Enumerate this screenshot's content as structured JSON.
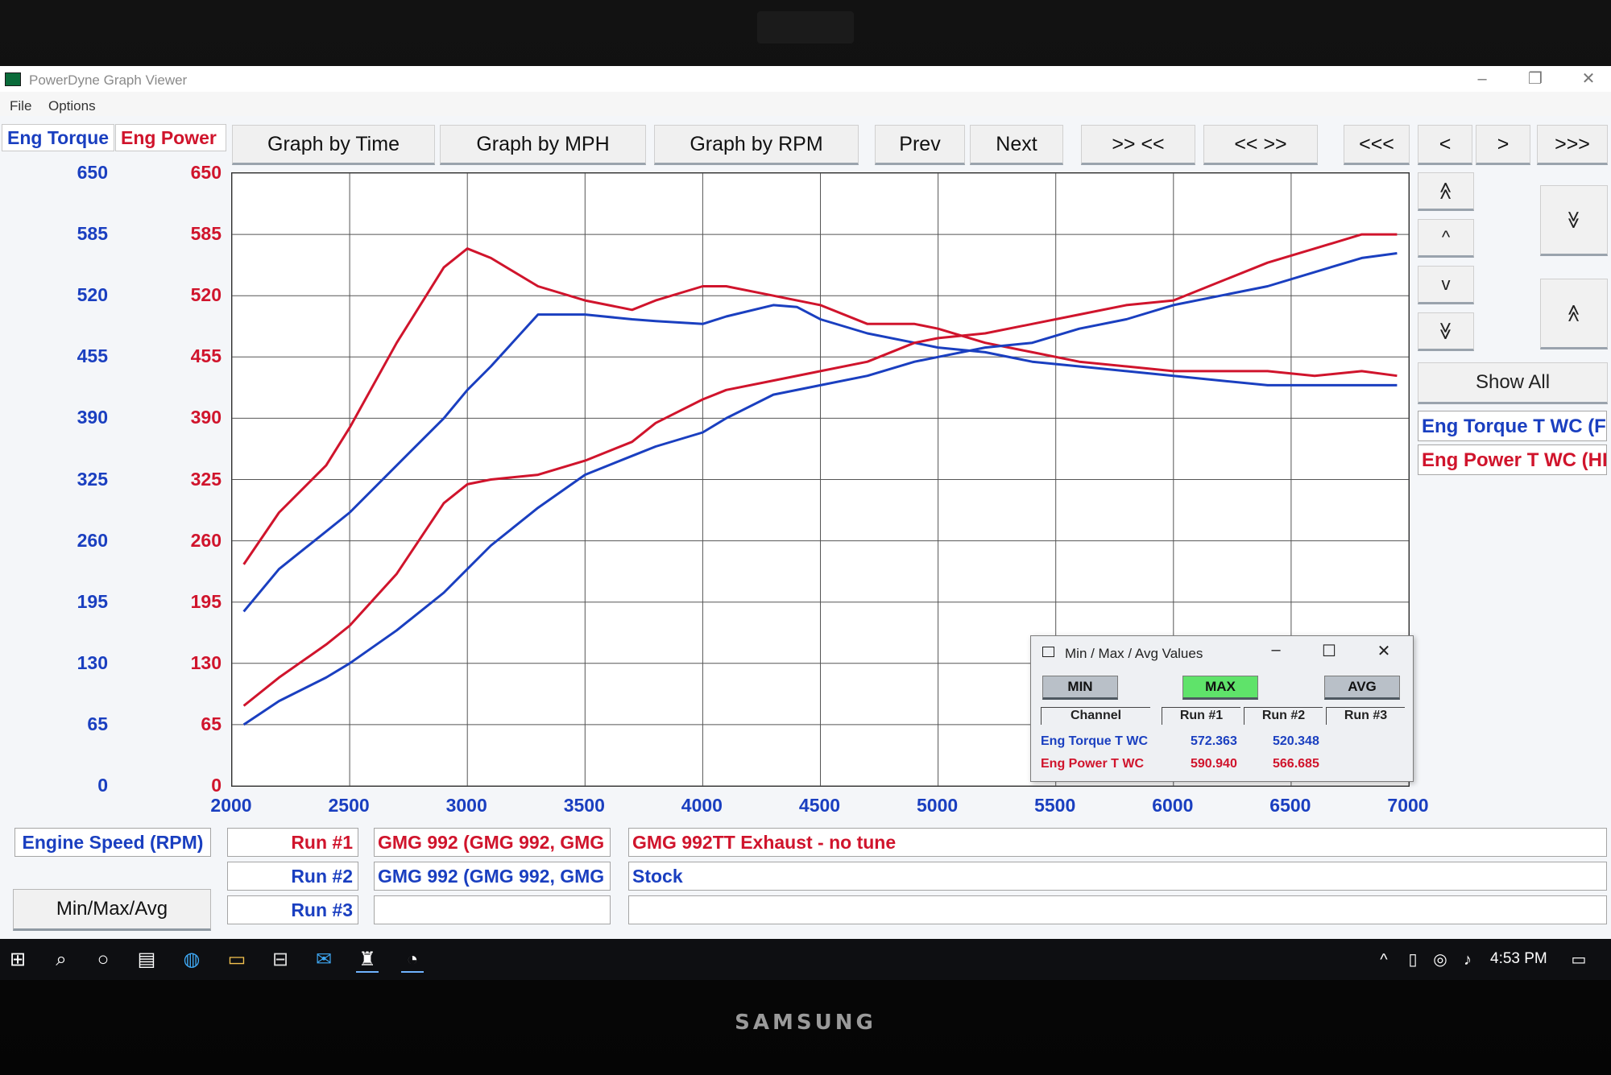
{
  "device": {
    "brand": "SAMSUNG"
  },
  "window": {
    "title": "PowerDyne Graph Viewer",
    "controls": {
      "minimize": "–",
      "restore": "❐",
      "close": "✕"
    },
    "menu": [
      "File",
      "Options"
    ]
  },
  "axes": {
    "torque_header": "Eng Torque",
    "power_header": "Eng Power",
    "y_ticks": [
      "650",
      "585",
      "520",
      "455",
      "390",
      "325",
      "260",
      "195",
      "130",
      "65",
      "0"
    ],
    "x_ticks": [
      "2000",
      "2500",
      "3000",
      "3500",
      "4000",
      "4500",
      "5000",
      "5500",
      "6000",
      "6500",
      "7000"
    ]
  },
  "toolbar": {
    "graph_by_time": "Graph by Time",
    "graph_by_mph": "Graph by MPH",
    "graph_by_rpm": "Graph by RPM",
    "prev": "Prev",
    "next": "Next",
    "zoom_in": ">> <<",
    "zoom_out": "<< >>",
    "first": "<<<",
    "back": "<",
    "forward": ">",
    "last": ">>>"
  },
  "right_panel": {
    "expand_up": "≫",
    "up": "^",
    "down": "v",
    "expand_down": "≫",
    "show_all": "Show All",
    "legend_torque": "Eng Torque T WC (F",
    "legend_power": "Eng Power T WC (HI"
  },
  "bottom": {
    "x_channel": "Engine Speed (RPM)",
    "minmax_button": "Min/Max/Avg",
    "runs": [
      {
        "label": "Run #1",
        "vehicle": "GMG 992 (GMG 992, GMG",
        "note": "GMG 992TT Exhaust - no tune"
      },
      {
        "label": "Run #2",
        "vehicle": "GMG 992 (GMG 992, GMG",
        "note": "Stock"
      },
      {
        "label": "Run #3",
        "vehicle": "",
        "note": ""
      }
    ]
  },
  "minmax": {
    "title": "Min / Max / Avg Values",
    "min": "MIN",
    "max": "MAX",
    "avg": "AVG",
    "headers": [
      "Channel",
      "Run #1",
      "Run #2",
      "Run #3"
    ],
    "rows": [
      {
        "channel": "Eng Torque T WC",
        "run1": "572.363",
        "run2": "520.348",
        "color": "#1a3fc0"
      },
      {
        "channel": "Eng Power T WC",
        "run1": "590.940",
        "run2": "566.685",
        "color": "#d0142c"
      }
    ]
  },
  "taskbar": {
    "time": "4:53 PM"
  },
  "colors": {
    "torque": "#1a3fc0",
    "power": "#d0142c",
    "max_active": "#5fe36a"
  },
  "chart_data": {
    "type": "line",
    "x_label": "Engine Speed (RPM)",
    "xlim": [
      2000,
      7000
    ],
    "ylim": [
      0,
      650
    ],
    "grid": true,
    "series": [
      {
        "name": "Eng Power T WC",
        "run": "Run #1",
        "color": "#d0142c",
        "x": [
          2050,
          2200,
          2400,
          2500,
          2700,
          2900,
          3000,
          3100,
          3300,
          3500,
          3700,
          3800,
          4000,
          4100,
          4300,
          4500,
          4700,
          4900,
          5000,
          5200,
          5400,
          5600,
          5800,
          6000,
          6200,
          6400,
          6600,
          6800,
          6950
        ],
        "y": [
          235,
          290,
          340,
          380,
          470,
          550,
          570,
          560,
          530,
          515,
          505,
          515,
          530,
          530,
          520,
          510,
          490,
          490,
          485,
          470,
          460,
          450,
          445,
          440,
          440,
          440,
          435,
          440,
          435
        ]
      },
      {
        "name": "Eng Torque T WC",
        "run": "Run #1",
        "color": "#1a3fc0",
        "x": [
          2050,
          2200,
          2400,
          2500,
          2700,
          2900,
          3000,
          3100,
          3300,
          3500,
          3700,
          3800,
          4000,
          4100,
          4300,
          4400,
          4500,
          4700,
          4900,
          5000,
          5200,
          5400,
          5600,
          5800,
          6000,
          6200,
          6400,
          6600,
          6800,
          6950
        ],
        "y": [
          185,
          230,
          270,
          290,
          340,
          390,
          420,
          445,
          500,
          500,
          495,
          493,
          490,
          498,
          510,
          508,
          495,
          480,
          470,
          465,
          460,
          450,
          445,
          440,
          435,
          430,
          425,
          425,
          425,
          425
        ]
      },
      {
        "name": "Eng Power T WC",
        "run": "Run #2",
        "color": "#d0142c",
        "x": [
          2050,
          2200,
          2400,
          2500,
          2700,
          2900,
          3000,
          3100,
          3300,
          3500,
          3700,
          3800,
          4000,
          4100,
          4300,
          4500,
          4700,
          4900,
          5000,
          5200,
          5400,
          5600,
          5800,
          6000,
          6200,
          6400,
          6600,
          6800,
          6950
        ],
        "y": [
          85,
          115,
          150,
          170,
          225,
          300,
          320,
          325,
          330,
          345,
          365,
          385,
          410,
          420,
          430,
          440,
          450,
          470,
          475,
          480,
          490,
          500,
          510,
          515,
          535,
          555,
          570,
          585,
          585
        ]
      },
      {
        "name": "Eng Torque T WC",
        "run": "Run #2",
        "color": "#1a3fc0",
        "x": [
          2050,
          2200,
          2400,
          2500,
          2700,
          2900,
          3000,
          3100,
          3300,
          3500,
          3700,
          3800,
          4000,
          4100,
          4300,
          4500,
          4700,
          4900,
          5000,
          5200,
          5400,
          5600,
          5800,
          6000,
          6200,
          6400,
          6600,
          6800,
          6950
        ],
        "y": [
          65,
          90,
          115,
          130,
          165,
          205,
          230,
          255,
          295,
          330,
          350,
          360,
          375,
          390,
          415,
          425,
          435,
          450,
          455,
          465,
          470,
          485,
          495,
          510,
          520,
          530,
          545,
          560,
          565
        ]
      }
    ]
  }
}
